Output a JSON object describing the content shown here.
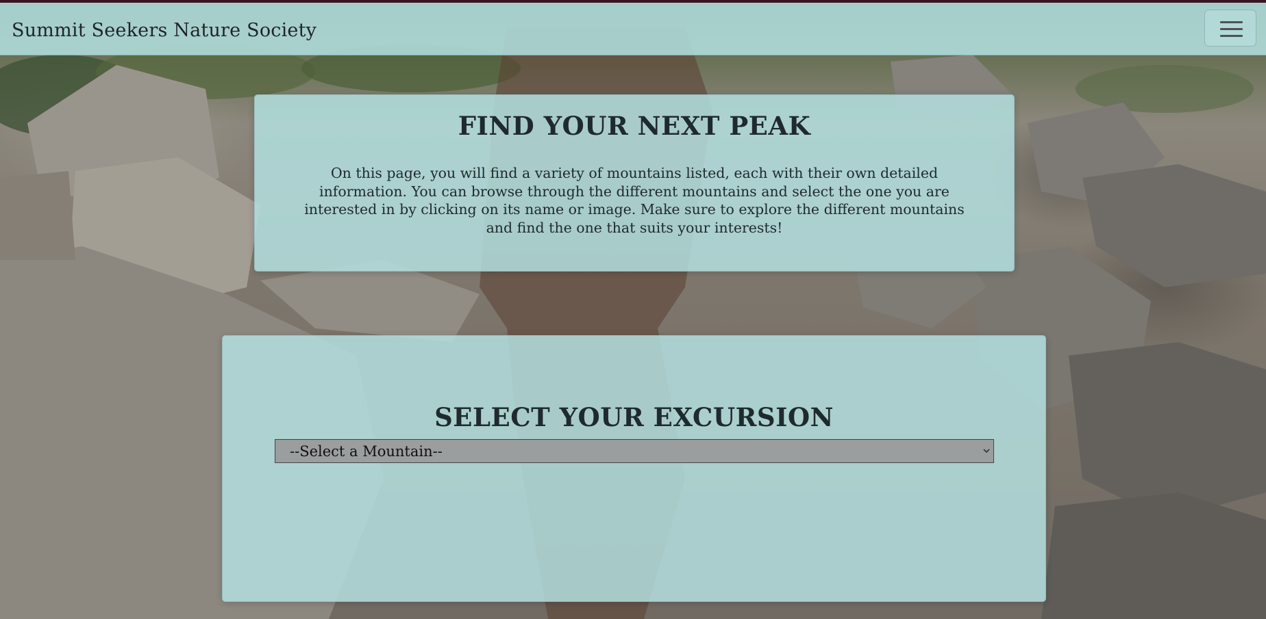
{
  "navbar": {
    "brand": "Summit Seekers Nature Society",
    "toggle_icon": "hamburger-menu-icon"
  },
  "intro": {
    "title": "FIND YOUR NEXT PEAK",
    "description": "On this page, you will find a variety of mountains listed, each with their own detailed information. You can browse through the different mountains and select the one you are interested in by clicking on its name or image. Make sure to explore the different mountains and find the one that suits your interests!"
  },
  "excursion": {
    "title": "SELECT YOUR EXCURSION",
    "select": {
      "selected": "--Select a Mountain--",
      "icon": "chevron-down-icon"
    }
  },
  "colors": {
    "panel": "#b2dede",
    "text": "#1f2a2e",
    "select_bg": "#9b9e9e",
    "top_strip": "#3a1422"
  }
}
